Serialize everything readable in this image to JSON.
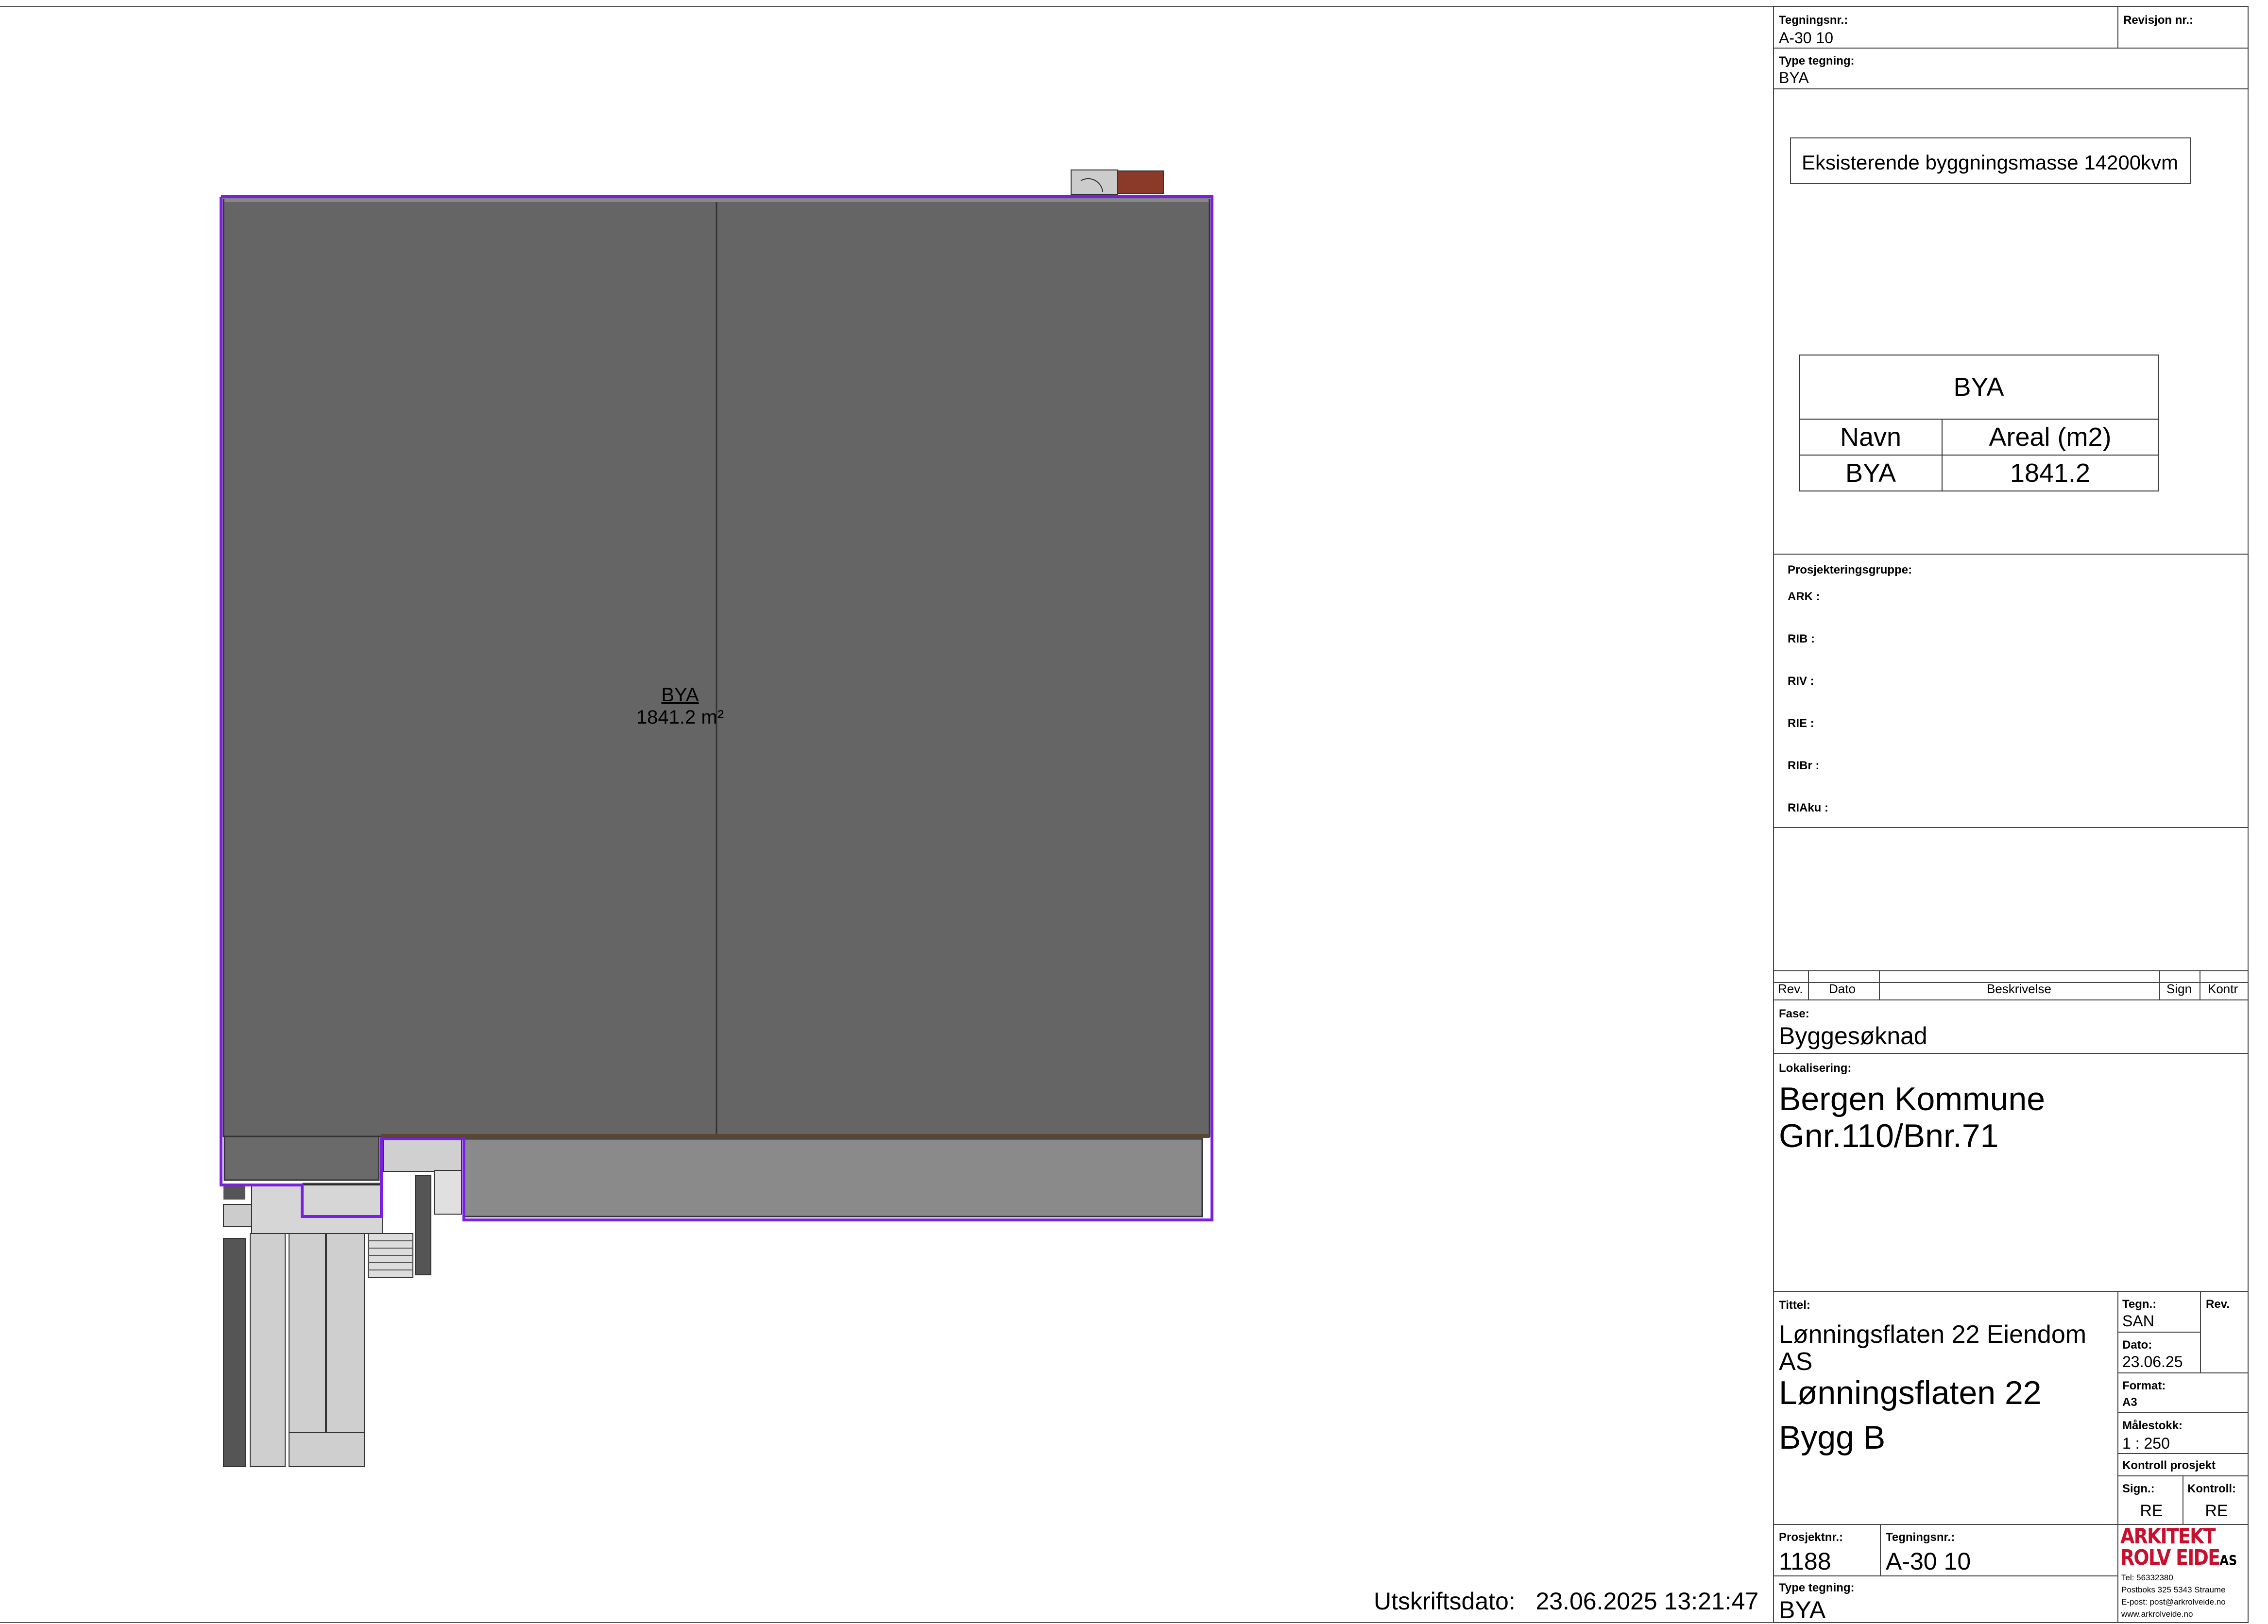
{
  "drawing": {
    "area_label": "BYA",
    "area_value": "1841.2 m²"
  },
  "print_date": {
    "label": "Utskriftsdato:",
    "value": "23.06.2025 13:21:47"
  },
  "titleblock": {
    "drawing_no_label": "Tegningsnr.:",
    "drawing_no": "A-30 10",
    "revision_label": "Revisjon nr.:",
    "type_label": "Type tegning:",
    "type_value": "BYA",
    "existing_mass": "Eksisterende byggningsmasse 14200kvm",
    "area_table": {
      "title": "BYA",
      "headers": [
        "Navn",
        "Areal (m2)"
      ],
      "rows": [
        [
          "BYA",
          "1841.2"
        ]
      ]
    },
    "project_group": {
      "title": "Prosjekteringsgruppe:",
      "roles": [
        "ARK :",
        "RIB :",
        "RIV :",
        "RIE :",
        "RIBr :",
        "RIAku :"
      ]
    },
    "revision_headers": [
      "Rev.",
      "Dato",
      "Beskrivelse",
      "Sign",
      "Kontr"
    ],
    "phase_label": "Fase:",
    "phase_value": "Byggesøknad",
    "location_label": "Lokalisering:",
    "location_lines": [
      "Bergen Kommune",
      "Gnr.110/Bnr.71"
    ],
    "title_label": "Tittel:",
    "title_lines": [
      "Lønningsflaten 22 Eiendom",
      "AS",
      "Lønningsflaten 22",
      "Bygg B"
    ],
    "drawn_label": "Tegn.:",
    "drawn_value": "SAN",
    "rev_label": "Rev.",
    "date_label": "Dato:",
    "date_value": "23.06.25",
    "format_label": "Format:",
    "format_value": "A3",
    "scale_label": "Målestokk:",
    "scale_value": "1 : 250",
    "control_label": "Kontroll prosjekt",
    "sign_label": "Sign.:",
    "sign_value": "RE",
    "control_by_label": "Kontroll:",
    "control_by_value": "RE",
    "project_no_label": "Prosjektnr.:",
    "project_no": "1188",
    "drawing_no_label2": "Tegningsnr.:",
    "drawing_no2": "A-30 10",
    "type_label2": "Type tegning:",
    "type_value2": "BYA"
  },
  "company": {
    "logo_line1": "ARKITEKT",
    "logo_line2": "ROLV EIDE",
    "logo_suffix": "AS",
    "contact": [
      "Tel: 56332380",
      "Postboks 325  5343 Straume",
      "E-post: post@arkrolveide.no",
      "www.arkrolveide.no"
    ]
  },
  "colors": {
    "building_fill": "#656565",
    "outline": "#7a1fe0",
    "logo_red": "#c8102e"
  }
}
